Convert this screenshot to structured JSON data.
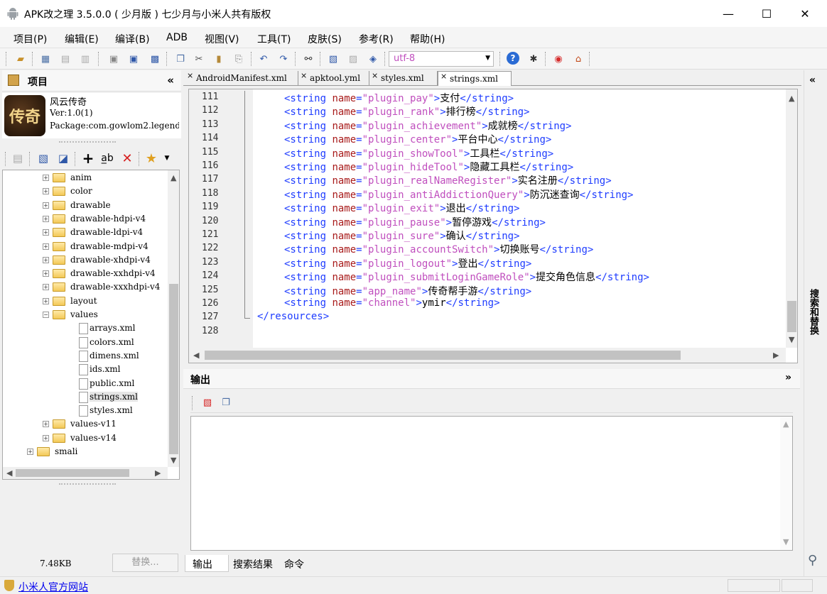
{
  "window": {
    "title": "APK改之理 3.5.0.0 ( 少月版 ) 七少月与小米人共有版权",
    "controls": {
      "minimize": "—",
      "maximize": "☐",
      "close": "✕"
    }
  },
  "menu": [
    "项目(P)",
    "编辑(E)",
    "编译(B)",
    "ADB",
    "视图(V)",
    "工具(T)",
    "皮肤(S)",
    "参考(R)",
    "帮助(H)"
  ],
  "toolbar": {
    "encoding": "utf-8"
  },
  "project_panel": {
    "title": "项目",
    "collapse": "«",
    "app_name": "风云传奇",
    "app_icon_text": "传奇",
    "version": "Ver:1.0(1)",
    "package": "Package:com.gowlom2.legend",
    "file_size": "7.48KB",
    "replace_button": "替换..."
  },
  "tree": [
    {
      "label": "anim",
      "type": "folder",
      "expanded": false,
      "depth": 2
    },
    {
      "label": "color",
      "type": "folder",
      "expanded": false,
      "depth": 2
    },
    {
      "label": "drawable",
      "type": "folder",
      "expanded": false,
      "depth": 2
    },
    {
      "label": "drawable-hdpi-v4",
      "type": "folder",
      "expanded": false,
      "depth": 2
    },
    {
      "label": "drawable-ldpi-v4",
      "type": "folder",
      "expanded": false,
      "depth": 2
    },
    {
      "label": "drawable-mdpi-v4",
      "type": "folder",
      "expanded": false,
      "depth": 2
    },
    {
      "label": "drawable-xhdpi-v4",
      "type": "folder",
      "expanded": false,
      "depth": 2
    },
    {
      "label": "drawable-xxhdpi-v4",
      "type": "folder",
      "expanded": false,
      "depth": 2
    },
    {
      "label": "drawable-xxxhdpi-v4",
      "type": "folder",
      "expanded": false,
      "depth": 2
    },
    {
      "label": "layout",
      "type": "folder",
      "expanded": false,
      "depth": 2
    },
    {
      "label": "values",
      "type": "folder",
      "expanded": true,
      "depth": 2
    },
    {
      "label": "arrays.xml",
      "type": "file",
      "depth": 3
    },
    {
      "label": "colors.xml",
      "type": "file",
      "depth": 3
    },
    {
      "label": "dimens.xml",
      "type": "file",
      "depth": 3
    },
    {
      "label": "ids.xml",
      "type": "file",
      "depth": 3
    },
    {
      "label": "public.xml",
      "type": "file",
      "depth": 3
    },
    {
      "label": "strings.xml",
      "type": "file",
      "depth": 3,
      "selected": true
    },
    {
      "label": "styles.xml",
      "type": "file",
      "depth": 3
    },
    {
      "label": "values-v11",
      "type": "folder",
      "expanded": false,
      "depth": 2
    },
    {
      "label": "values-v14",
      "type": "folder",
      "expanded": false,
      "depth": 2
    },
    {
      "label": "smali",
      "type": "folder",
      "expanded": false,
      "depth": 1
    }
  ],
  "tabs": [
    "AndroidManifest.xml",
    "apktool.yml",
    "styles.xml",
    "strings.xml"
  ],
  "active_tab": "strings.xml",
  "code": [
    {
      "num": "111",
      "name": "plugin_pay",
      "text": "支付"
    },
    {
      "num": "112",
      "name": "plugin_rank",
      "text": "排行榜"
    },
    {
      "num": "113",
      "name": "plugin_achievement",
      "text": "成就榜"
    },
    {
      "num": "114",
      "name": "plugin_center",
      "text": "平台中心"
    },
    {
      "num": "115",
      "name": "plugin_showTool",
      "text": "工具栏"
    },
    {
      "num": "116",
      "name": "plugin_hideTool",
      "text": "隐藏工具栏"
    },
    {
      "num": "117",
      "name": "plugin_realNameRegister",
      "text": "实名注册"
    },
    {
      "num": "118",
      "name": "plugin_antiAddictionQuery",
      "text": "防沉迷查询"
    },
    {
      "num": "119",
      "name": "plugin_exit",
      "text": "退出"
    },
    {
      "num": "120",
      "name": "plugin_pause",
      "text": "暂停游戏"
    },
    {
      "num": "121",
      "name": "plugin_sure",
      "text": "确认"
    },
    {
      "num": "122",
      "name": "plugin_accountSwitch",
      "text": "切换账号"
    },
    {
      "num": "123",
      "name": "plugin_logout",
      "text": "登出"
    },
    {
      "num": "124",
      "name": "plugin_submitLoginGameRole",
      "text": "提交角色信息"
    },
    {
      "num": "125",
      "name": "app_name",
      "text": "传奇帮手游"
    },
    {
      "num": "126",
      "name": "channel",
      "text": "ymir"
    }
  ],
  "code_closing": {
    "num": "127",
    "text": "</resources>"
  },
  "code_empty": {
    "num": "128"
  },
  "output": {
    "title": "输出",
    "collapse": "»",
    "tabs": [
      "输出",
      "搜索结果",
      "命令"
    ]
  },
  "right_panel": {
    "label": "搜索和替换",
    "collapse": "«"
  },
  "status": {
    "link": "小米人官方网站"
  }
}
